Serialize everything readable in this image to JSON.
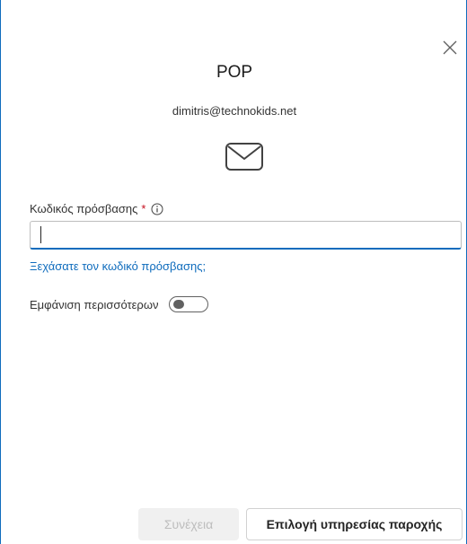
{
  "dialog": {
    "title": "POP",
    "email": "dimitris@technokids.net",
    "close_icon": "close-icon",
    "mail_icon": "mail-envelope-icon"
  },
  "password": {
    "label": "Κωδικός πρόσβασης",
    "required_marker": "*",
    "info_icon": "info-icon",
    "value": "",
    "placeholder": ""
  },
  "forgot_link": "Ξεχάσατε τον κωδικό πρόσβασης;",
  "show_more": {
    "label": "Εμφάνιση περισσότερων",
    "toggle_on": false
  },
  "buttons": {
    "continue_label": "Συνέχεια",
    "continue_enabled": false,
    "provider_label": "Επιλογή υπηρεσίας παροχής"
  },
  "colors": {
    "accent": "#0f6cbd",
    "required": "#c50f1f",
    "disabled_bg": "#f0f0f0",
    "disabled_text": "#bdbdbd"
  }
}
